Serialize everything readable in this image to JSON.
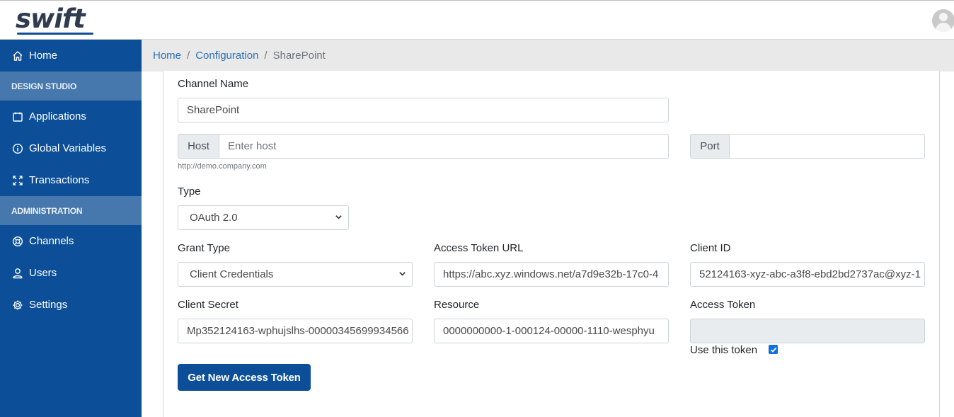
{
  "app": {
    "logo": "swift"
  },
  "sidebar": {
    "home": "Home",
    "section_design": "DESIGN STUDIO",
    "applications": "Applications",
    "global_variables": "Global Variables",
    "transactions": "Transactions",
    "section_admin": "ADMINISTRATION",
    "channels": "Channels",
    "users": "Users",
    "settings": "Settings"
  },
  "breadcrumb": {
    "home": "Home",
    "sep": "/",
    "configuration": "Configuration",
    "current": "SharePoint"
  },
  "form": {
    "channel_name_label": "Channel Name",
    "channel_name_value": "SharePoint",
    "host_addon": "Host",
    "host_placeholder": "Enter host",
    "host_help": "http://demo.company.com",
    "port_addon": "Port",
    "port_value": "",
    "type_label": "Type",
    "type_value": "OAuth 2.0",
    "grant_type_label": "Grant Type",
    "grant_type_value": "Client Credentials",
    "access_token_url_label": "Access Token URL",
    "access_token_url_value": "https://abc.xyz.windows.net/a7d9e32b-17c0-4",
    "client_id_label": "Client ID",
    "client_id_value": "52124163-xyz-abc-a3f8-ebd2bd2737ac@xyz-1",
    "client_secret_label": "Client Secret",
    "client_secret_value": "Mp352124163-wphujslhs-00000345699934566",
    "resource_label": "Resource",
    "resource_value": "0000000000-1-000124-00000-1110-wesphyu",
    "access_token_label": "Access Token",
    "access_token_value": "",
    "use_token_label": "Use this token",
    "use_token_checked": true,
    "get_token_button": "Get New Access Token"
  },
  "colors": {
    "sidebar": "#0c4f98",
    "sidebar_section": "#4678ae",
    "accent_link": "#2a6fb4",
    "button": "#0c4f98",
    "checkbox": "#0f6ee0"
  }
}
